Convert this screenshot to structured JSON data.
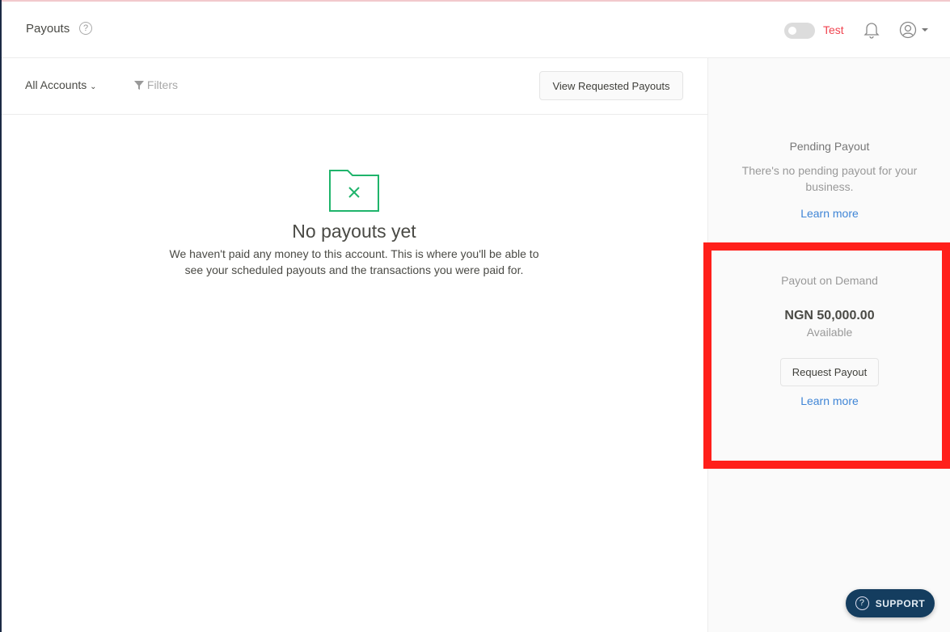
{
  "header": {
    "title": "Payouts",
    "mode_label": "Test",
    "mode_enabled": false
  },
  "toolbar": {
    "accounts_label": "All Accounts",
    "filters_label": "Filters",
    "view_requested_label": "View Requested Payouts"
  },
  "empty_state": {
    "title": "No payouts yet",
    "description": "We haven't paid any money to this account. This is where you'll be able to see your scheduled payouts and the transactions you were paid for."
  },
  "sidebar": {
    "pending": {
      "title": "Pending Payout",
      "text": "There's no pending payout for your business.",
      "link": "Learn more"
    },
    "on_demand": {
      "title": "Payout on Demand",
      "amount": "NGN 50,000.00",
      "amount_label": "Available",
      "button": "Request Payout",
      "link": "Learn more"
    }
  },
  "support": {
    "label": "SUPPORT"
  },
  "colors": {
    "accent_green": "#1fb46b",
    "link_blue": "#3f85d6",
    "test_red": "#f0434f",
    "support_navy": "#143d5f",
    "highlight_red": "#ff1f1a"
  }
}
